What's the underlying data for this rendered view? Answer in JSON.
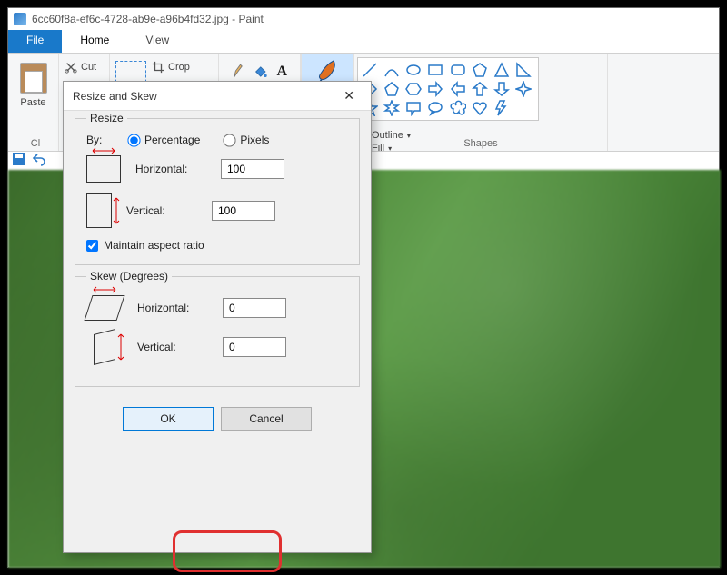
{
  "title": "6cc60f8a-ef6c-4728-ab9e-a96b4fd32.jpg - Paint",
  "menutabs": {
    "file": "File",
    "home": "Home",
    "view": "View"
  },
  "ribbon": {
    "paste": "Paste",
    "cut": "Cut",
    "crop": "Crop",
    "clipboard_label": "Cl",
    "brushes": "Brushes",
    "outline": "Outline",
    "fill": "Fill",
    "shapes_label": "Shapes"
  },
  "dialog": {
    "title": "Resize and Skew",
    "resize": {
      "legend": "Resize",
      "by": "By:",
      "percentage": "Percentage",
      "pixels": "Pixels",
      "horizontal": "Horizontal:",
      "vertical": "Vertical:",
      "h_val": "100",
      "v_val": "100",
      "aspect": "Maintain aspect ratio"
    },
    "skew": {
      "legend": "Skew (Degrees)",
      "horizontal": "Horizontal:",
      "vertical": "Vertical:",
      "h_val": "0",
      "v_val": "0"
    },
    "ok": "OK",
    "cancel": "Cancel"
  }
}
